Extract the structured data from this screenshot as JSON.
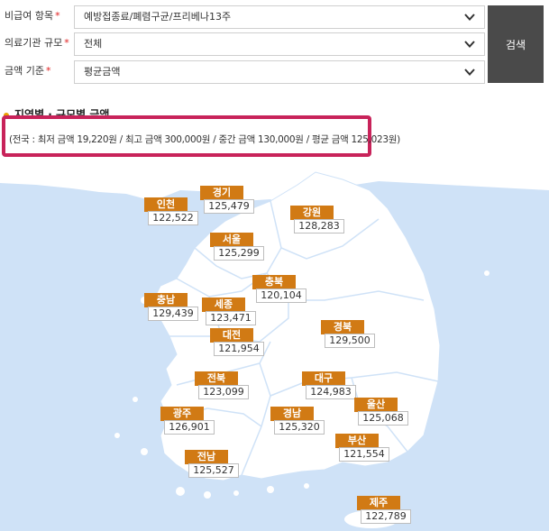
{
  "filters": [
    {
      "label": "비급여 항목",
      "required": "*",
      "value": "예방접종료/폐렴구균/프리베나13주"
    },
    {
      "label": "의료기관 규모",
      "required": "*",
      "value": "전체"
    },
    {
      "label": "금액 기준",
      "required": "*",
      "value": "평균금액"
    }
  ],
  "search_button": "검색",
  "section_title": "지역별 · 규모별 금액",
  "summary": "(전국 : 최저 금액 19,220원 / 최고 금액 300,000원 / 중간 금액 130,000원 / 평균 금액 125,023원)",
  "colors": {
    "accent": "#d17a14",
    "highlight": "#c8235a",
    "sea": "#cfe2f7",
    "land": "#ffffff"
  },
  "regions": [
    {
      "name": "경기",
      "value": "125,479"
    },
    {
      "name": "인천",
      "value": "122,522"
    },
    {
      "name": "강원",
      "value": "128,283"
    },
    {
      "name": "서울",
      "value": "125,299"
    },
    {
      "name": "충북",
      "value": "120,104"
    },
    {
      "name": "충남",
      "value": "129,439"
    },
    {
      "name": "세종",
      "value": "123,471"
    },
    {
      "name": "대전",
      "value": "121,954"
    },
    {
      "name": "경북",
      "value": "129,500"
    },
    {
      "name": "전북",
      "value": "123,099"
    },
    {
      "name": "대구",
      "value": "124,983"
    },
    {
      "name": "광주",
      "value": "126,901"
    },
    {
      "name": "경남",
      "value": "125,320"
    },
    {
      "name": "울산",
      "value": "125,068"
    },
    {
      "name": "부산",
      "value": "121,554"
    },
    {
      "name": "전남",
      "value": "125,527"
    },
    {
      "name": "제주",
      "value": "122,789"
    }
  ]
}
